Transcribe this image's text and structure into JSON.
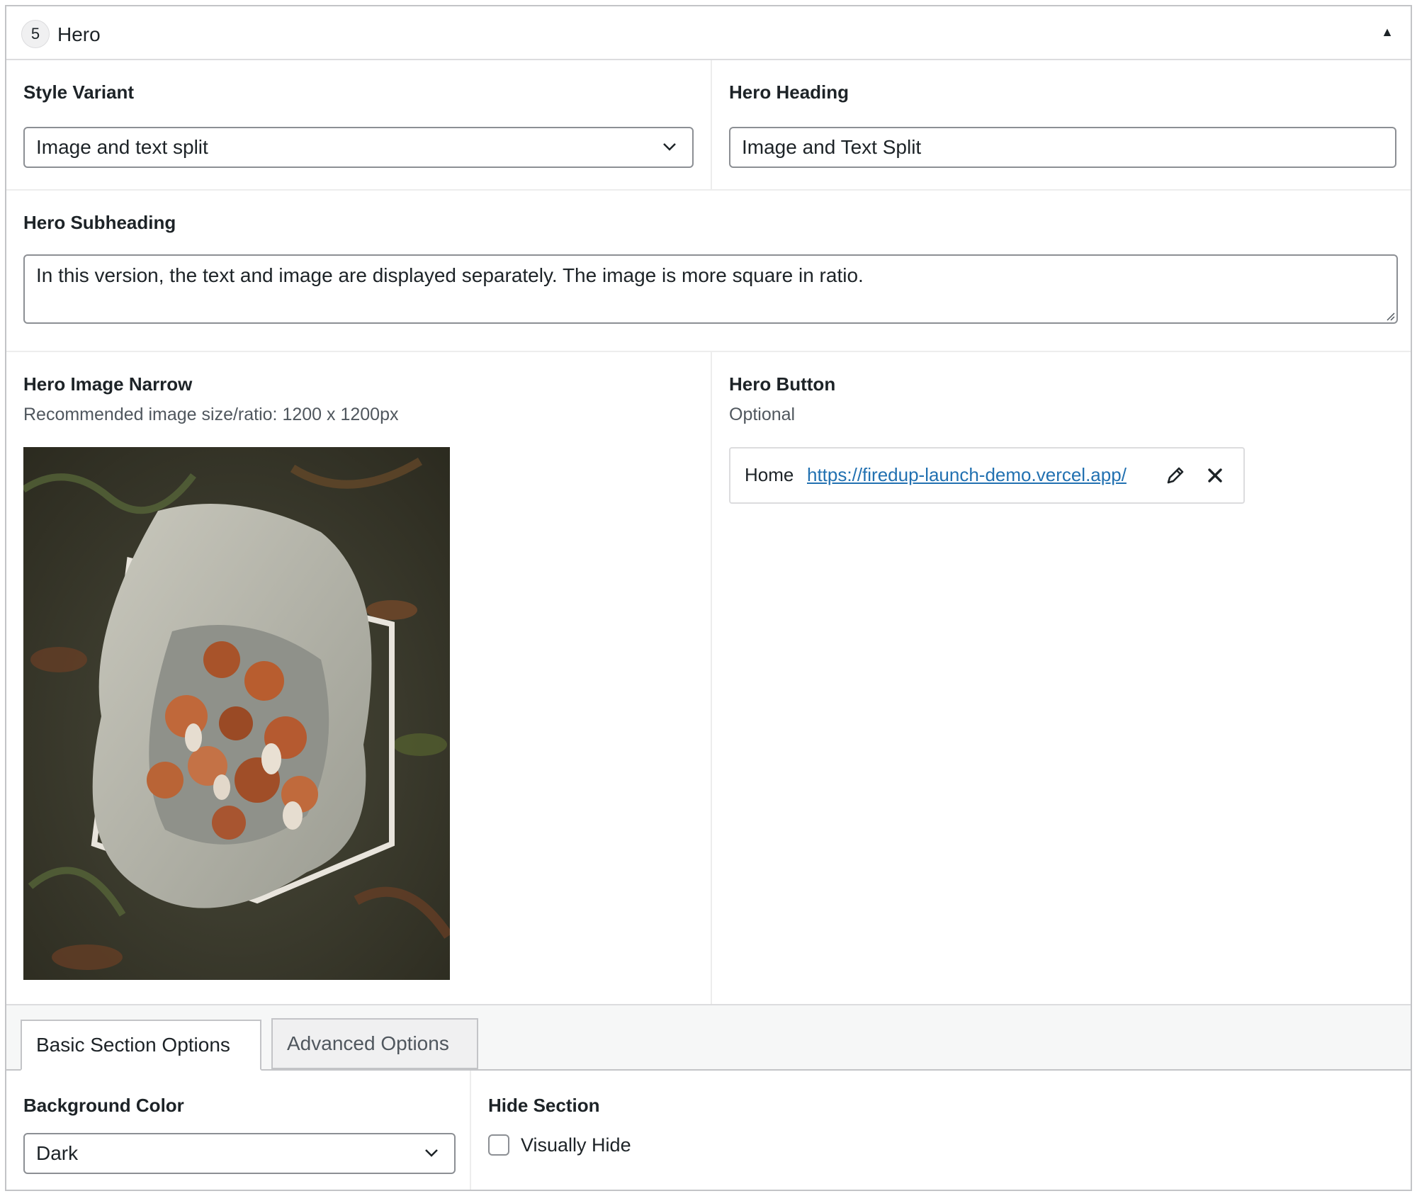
{
  "section": {
    "number": "5",
    "title": "Hero"
  },
  "fields": {
    "style_variant": {
      "label": "Style Variant",
      "value": "Image and text split"
    },
    "hero_heading": {
      "label": "Hero Heading",
      "value": "Image and Text Split"
    },
    "hero_subheading": {
      "label": "Hero Subheading",
      "value": "In this version, the text and image are displayed separately. The image is more square in ratio."
    },
    "hero_image": {
      "label": "Hero Image Narrow",
      "description": "Recommended image size/ratio: 1200 x 1200px"
    },
    "hero_button": {
      "label": "Hero Button",
      "description": "Optional",
      "link_title": "Home",
      "link_url": "https://firedup-launch-demo.vercel.app/"
    }
  },
  "tabs": [
    {
      "label": "Basic Section Options",
      "active": true
    },
    {
      "label": "Advanced Options",
      "active": false
    }
  ],
  "options": {
    "background_color": {
      "label": "Background Color",
      "value": "Dark"
    },
    "hide_section": {
      "label": "Hide Section",
      "checkbox_label": "Visually Hide",
      "checked": false
    }
  },
  "icons": {
    "collapse": "triangle-up-icon",
    "select": "chevron-down-icon",
    "edit": "pencil-icon",
    "remove": "close-icon"
  },
  "colors": {
    "link": "#2271b1",
    "border": "#8c8f94",
    "text": "#1d2327"
  }
}
